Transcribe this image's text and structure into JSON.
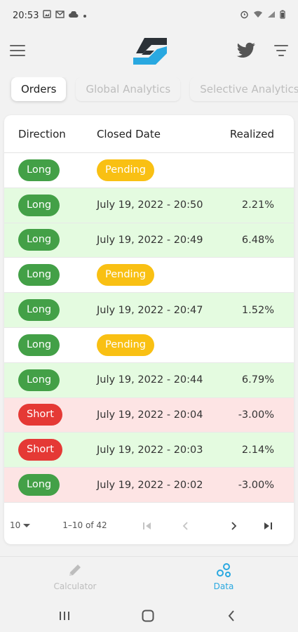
{
  "status_bar": {
    "time": "20:53"
  },
  "tabs": [
    {
      "label": "Orders"
    },
    {
      "label": "Global Analytics"
    },
    {
      "label": "Selective Analytics"
    }
  ],
  "table": {
    "headers": {
      "direction": "Direction",
      "closed_date": "Closed Date",
      "realized": "Realized"
    },
    "rows": [
      {
        "direction": "Long",
        "closed_date": "Pending",
        "realized": "",
        "status": "neutral"
      },
      {
        "direction": "Long",
        "closed_date": "July 19, 2022 - 20:50",
        "realized": "2.21%",
        "status": "positive"
      },
      {
        "direction": "Long",
        "closed_date": "July 19, 2022 - 20:49",
        "realized": "6.48%",
        "status": "positive"
      },
      {
        "direction": "Long",
        "closed_date": "Pending",
        "realized": "",
        "status": "neutral"
      },
      {
        "direction": "Long",
        "closed_date": "July 19, 2022 - 20:47",
        "realized": "1.52%",
        "status": "positive"
      },
      {
        "direction": "Long",
        "closed_date": "Pending",
        "realized": "",
        "status": "neutral"
      },
      {
        "direction": "Long",
        "closed_date": "July 19, 2022 - 20:44",
        "realized": "6.79%",
        "status": "positive"
      },
      {
        "direction": "Short",
        "closed_date": "July 19, 2022 - 20:04",
        "realized": "-3.00%",
        "status": "negative"
      },
      {
        "direction": "Short",
        "closed_date": "July 19, 2022 - 20:03",
        "realized": "2.14%",
        "status": "positive"
      },
      {
        "direction": "Long",
        "closed_date": "July 19, 2022 - 20:02",
        "realized": "-3.00%",
        "status": "negative"
      }
    ]
  },
  "pagination": {
    "rows_per_page": "10",
    "range_label": "1–10 of 42"
  },
  "bottom_nav": [
    {
      "label": "Calculator",
      "icon": "pencil-icon",
      "active": false
    },
    {
      "label": "Data",
      "icon": "data-icon",
      "active": true
    }
  ],
  "colors": {
    "long": "#43a047",
    "short": "#e53935",
    "pending": "#f9c013",
    "positive_row": "#e4fbe0",
    "negative_row": "#fde4e4",
    "accent": "#29a8e0"
  }
}
